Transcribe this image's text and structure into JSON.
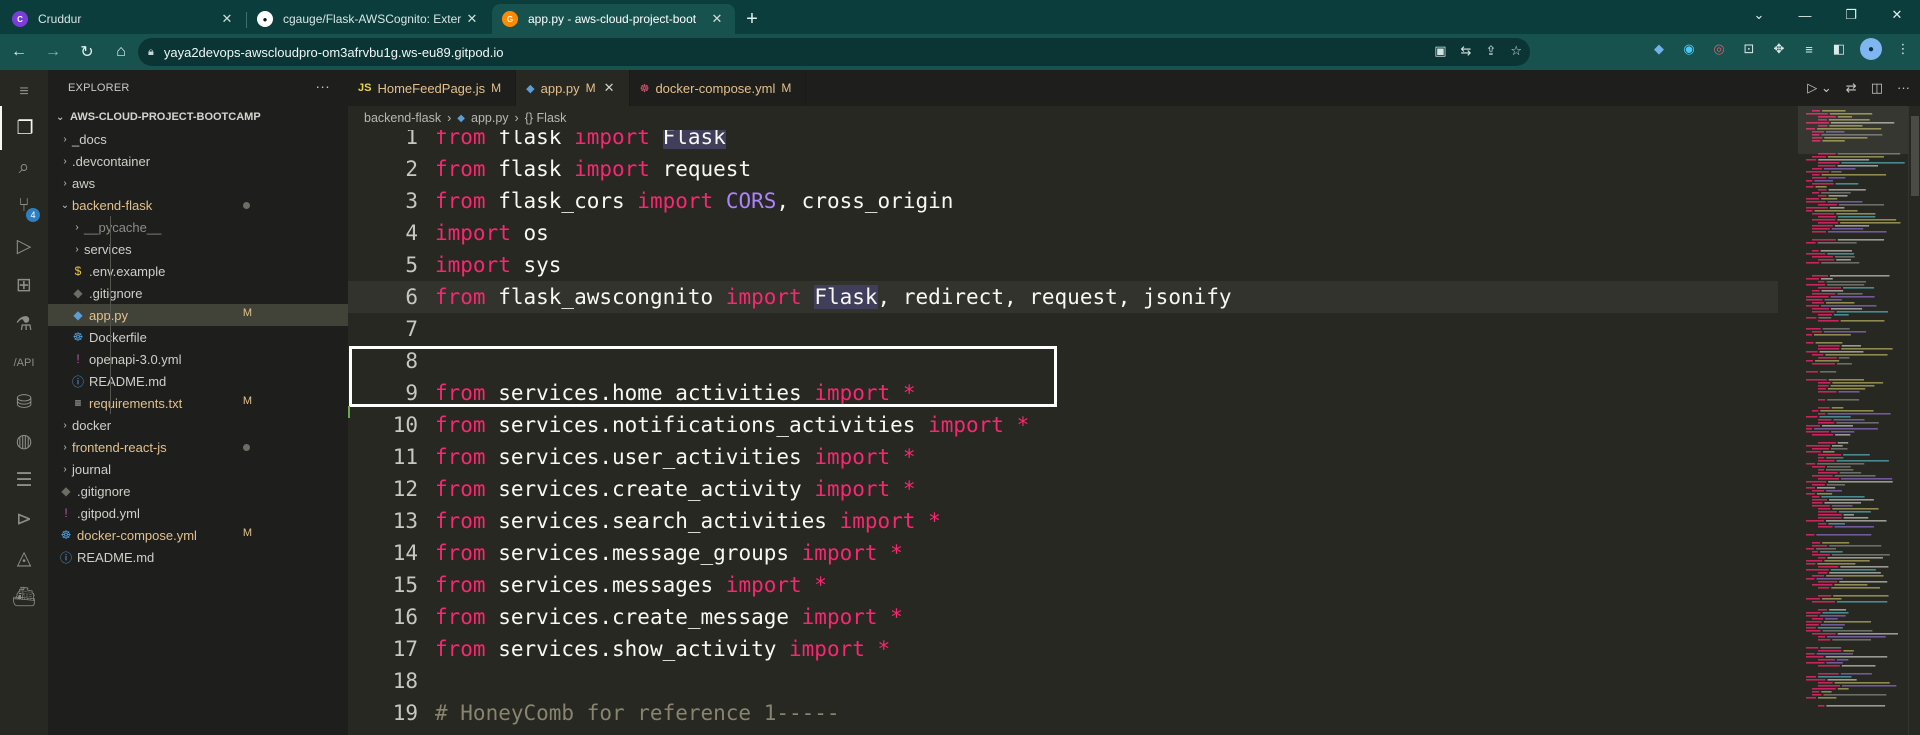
{
  "browser": {
    "tabs": [
      {
        "title": "Cruddur",
        "favicon": "cruddur-favicon",
        "active": false
      },
      {
        "title": "cgauge/Flask-AWSCognito: Exter",
        "favicon": "github-icon",
        "active": false
      },
      {
        "title": "app.py - aws-cloud-project-boot",
        "favicon": "gitpod-icon",
        "active": true
      }
    ],
    "url": "yaya2devops-awscloudpro-om3afrvbu1g.ws-eu89.gitpod.io"
  },
  "activity_bar": {
    "items": [
      "explorer-icon",
      "search-icon",
      "source-control-icon",
      "run-debug-icon",
      "extensions-icon",
      "testing-icon",
      "api-icon",
      "database-icon",
      "github-icon",
      "stack-icon",
      "terminal-icon",
      "azure-icon",
      "docker-icon"
    ],
    "source_control_badge": "4"
  },
  "explorer": {
    "title": "EXPLORER",
    "project": "AWS-CLOUD-PROJECT-BOOTCAMP",
    "rows": [
      {
        "label": "_docs",
        "type": "folder",
        "depth": 0,
        "open": false,
        "status": ""
      },
      {
        "label": ".devcontainer",
        "type": "folder",
        "depth": 0,
        "open": false,
        "status": ""
      },
      {
        "label": "aws",
        "type": "folder",
        "depth": 0,
        "open": false,
        "status": ""
      },
      {
        "label": "backend-flask",
        "type": "folder",
        "depth": 0,
        "open": true,
        "status": "dot"
      },
      {
        "label": "__pycache__",
        "type": "folder",
        "depth": 1,
        "open": false,
        "status": "ignored"
      },
      {
        "label": "services",
        "type": "folder",
        "depth": 1,
        "open": false,
        "status": ""
      },
      {
        "label": ".env.example",
        "type": "env",
        "depth": 1,
        "status": ""
      },
      {
        "label": ".gitignore",
        "type": "git",
        "depth": 1,
        "status": ""
      },
      {
        "label": "app.py",
        "type": "python",
        "depth": 1,
        "status": "M",
        "selected": true
      },
      {
        "label": "Dockerfile",
        "type": "docker",
        "depth": 1,
        "status": ""
      },
      {
        "label": "openapi-3.0.yml",
        "type": "yaml",
        "depth": 1,
        "status": ""
      },
      {
        "label": "README.md",
        "type": "info",
        "depth": 1,
        "status": ""
      },
      {
        "label": "requirements.txt",
        "type": "text",
        "depth": 1,
        "status": "M"
      },
      {
        "label": "docker",
        "type": "folder",
        "depth": 0,
        "open": false,
        "status": ""
      },
      {
        "label": "frontend-react-js",
        "type": "folder",
        "depth": 0,
        "open": false,
        "status": "dot"
      },
      {
        "label": "journal",
        "type": "folder",
        "depth": 0,
        "open": false,
        "status": ""
      },
      {
        "label": ".gitignore",
        "type": "git",
        "depth": 0,
        "status": ""
      },
      {
        "label": ".gitpod.yml",
        "type": "yaml",
        "depth": 0,
        "status": ""
      },
      {
        "label": "docker-compose.yml",
        "type": "docker",
        "depth": 0,
        "status": "M"
      },
      {
        "label": "README.md",
        "type": "info",
        "depth": 0,
        "status": ""
      }
    ]
  },
  "editor": {
    "tabs": [
      {
        "label": "HomeFeedPage.js",
        "icon": "JS",
        "status": "M",
        "active": false
      },
      {
        "label": "app.py",
        "icon": "py",
        "status": "M",
        "active": true
      },
      {
        "label": "docker-compose.yml",
        "icon": "docker",
        "status": "M",
        "active": false
      }
    ],
    "breadcrumbs": [
      "backend-flask",
      "app.py",
      "{} Flask"
    ],
    "lines": [
      {
        "n": "1",
        "tokens": [
          [
            "kw",
            "from"
          ],
          [
            "",
            "  flask "
          ],
          [
            "kw",
            "import"
          ],
          [
            "",
            ""
          ],
          [
            "hl",
            "Flask"
          ]
        ]
      },
      {
        "n": "2",
        "tokens": [
          [
            "kw",
            "from"
          ],
          [
            "",
            "  flask "
          ],
          [
            "kw",
            "import"
          ],
          [
            "",
            " request"
          ]
        ]
      },
      {
        "n": "3",
        "tokens": [
          [
            "kw",
            "from"
          ],
          [
            "",
            "  flask_cors "
          ],
          [
            "kw",
            "import"
          ],
          [
            "",
            ""
          ],
          [
            "cls",
            "CORS"
          ],
          [
            "",
            ", cross_origin"
          ]
        ]
      },
      {
        "n": "4",
        "tokens": [
          [
            "kw",
            "import"
          ],
          [
            "",
            " os"
          ]
        ]
      },
      {
        "n": "5",
        "tokens": [
          [
            "kw",
            "import"
          ],
          [
            "",
            " sys"
          ]
        ]
      },
      {
        "n": "6",
        "tokens": [
          [
            "kw",
            "from"
          ],
          [
            "",
            "  flask_awscongnito "
          ],
          [
            "kw",
            "import"
          ],
          [
            "",
            ""
          ],
          [
            "hl",
            "Flask"
          ],
          [
            "",
            ", redirect, request, jsonify"
          ]
        ]
      },
      {
        "n": "7",
        "tokens": []
      },
      {
        "n": "8",
        "tokens": []
      },
      {
        "n": "9",
        "tokens": [
          [
            "kw",
            "from"
          ],
          [
            "",
            "  services.home_activities "
          ],
          [
            "kw",
            "import"
          ],
          [
            "kw",
            " *"
          ]
        ]
      },
      {
        "n": "10",
        "tokens": [
          [
            "kw",
            "from"
          ],
          [
            "",
            "  services.notifications_activities "
          ],
          [
            "kw",
            "import"
          ],
          [
            "kw",
            " *"
          ]
        ]
      },
      {
        "n": "11",
        "tokens": [
          [
            "kw",
            "from"
          ],
          [
            "",
            "  services.user_activities "
          ],
          [
            "kw",
            "import"
          ],
          [
            "kw",
            " *"
          ]
        ]
      },
      {
        "n": "12",
        "tokens": [
          [
            "kw",
            "from"
          ],
          [
            "",
            "  services.create_activity "
          ],
          [
            "kw",
            "import"
          ],
          [
            "kw",
            " *"
          ]
        ]
      },
      {
        "n": "13",
        "tokens": [
          [
            "kw",
            "from"
          ],
          [
            "",
            "  services.search_activities "
          ],
          [
            "kw",
            "import"
          ],
          [
            "kw",
            " *"
          ]
        ]
      },
      {
        "n": "14",
        "tokens": [
          [
            "kw",
            "from"
          ],
          [
            "",
            "  services.message_groups "
          ],
          [
            "kw",
            "import"
          ],
          [
            "kw",
            " *"
          ]
        ]
      },
      {
        "n": "15",
        "tokens": [
          [
            "kw",
            "from"
          ],
          [
            "",
            "  services.messages "
          ],
          [
            "kw",
            "import"
          ],
          [
            "kw",
            " *"
          ]
        ]
      },
      {
        "n": "16",
        "tokens": [
          [
            "kw",
            "from"
          ],
          [
            "",
            "  services.create_message "
          ],
          [
            "kw",
            "import"
          ],
          [
            "kw",
            " *"
          ]
        ]
      },
      {
        "n": "17",
        "tokens": [
          [
            "kw",
            "from"
          ],
          [
            "",
            "  services.show_activity "
          ],
          [
            "kw",
            "import"
          ],
          [
            "kw",
            " *"
          ]
        ]
      },
      {
        "n": "18",
        "tokens": []
      },
      {
        "n": "19",
        "tokens": [
          [
            "cmt",
            "# HoneyComb for reference 1-----"
          ]
        ]
      }
    ],
    "current_line": "6",
    "colors": {
      "keyword": "#f92672",
      "class": "#ae81ff",
      "comment": "#88846f",
      "text": "#f8f8f2",
      "background": "#272822",
      "modified": "#e2c08d"
    }
  }
}
